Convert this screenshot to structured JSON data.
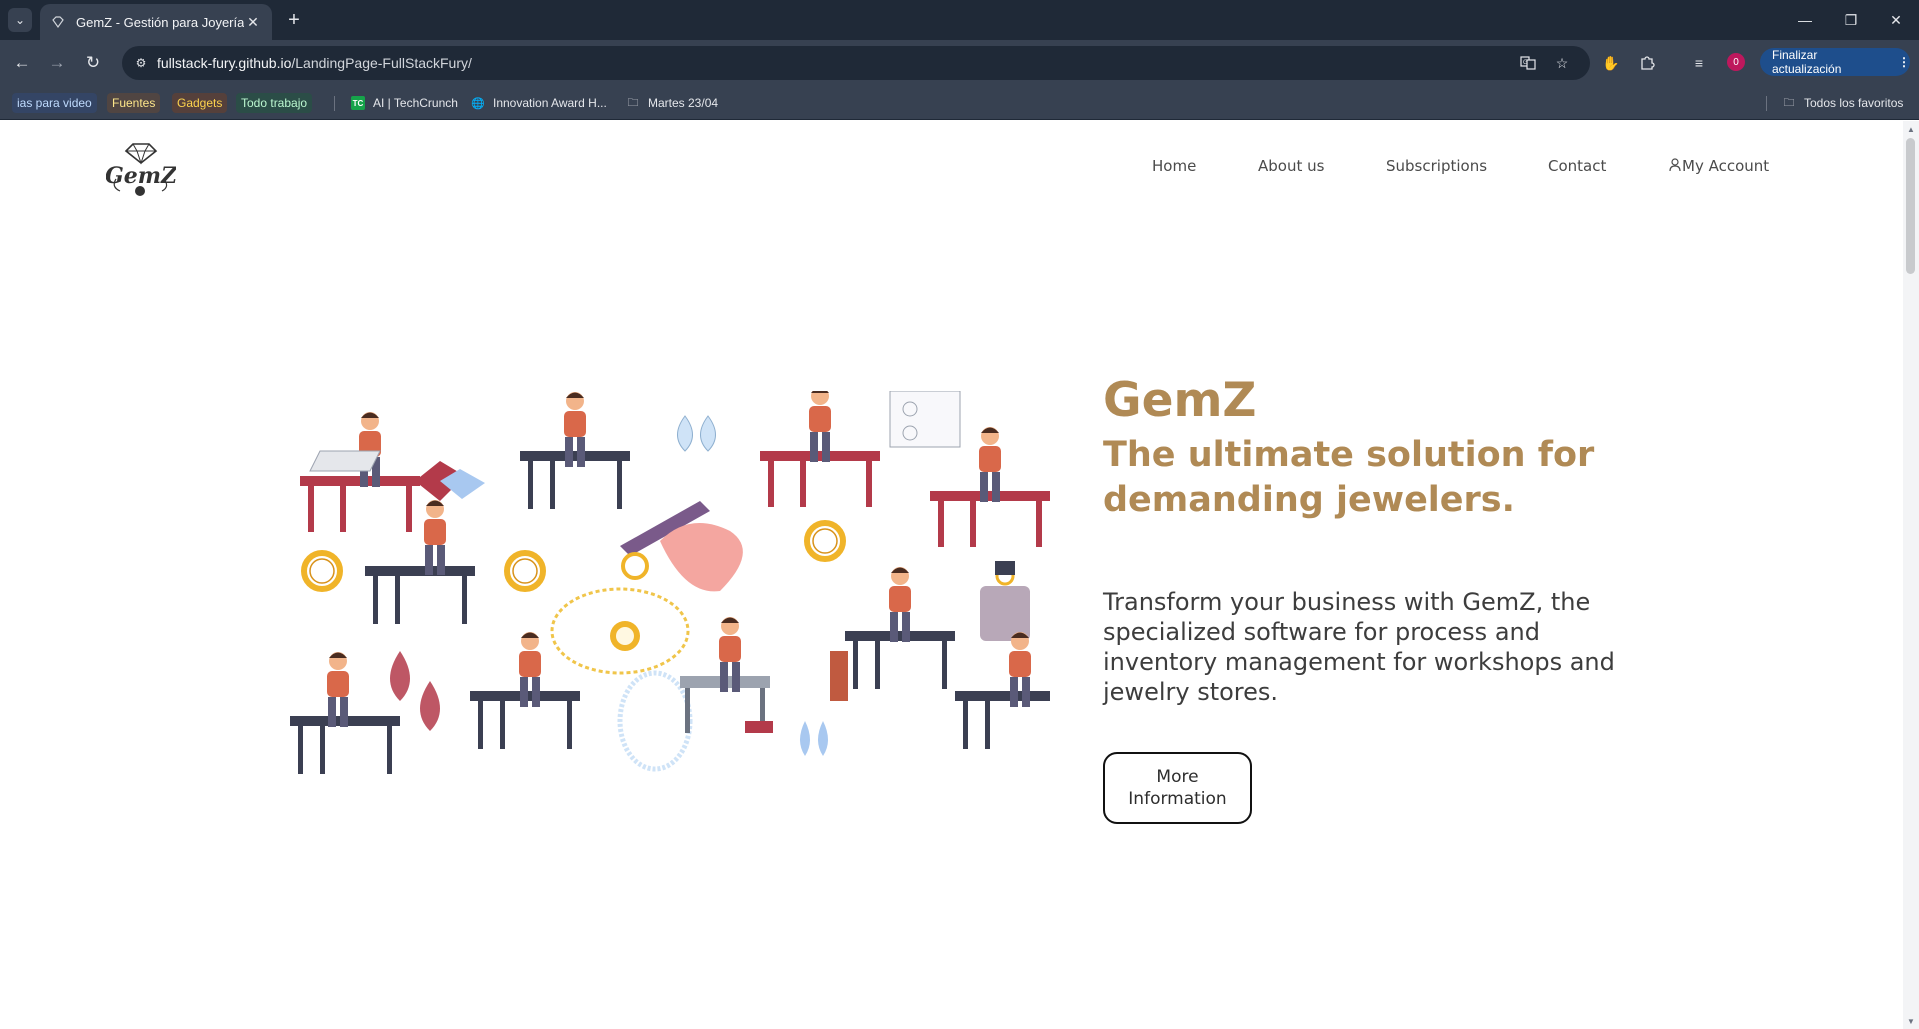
{
  "browser": {
    "tab": {
      "title": "GemZ - Gestión para Joyerías"
    },
    "url": {
      "host": "fullstack-fury.github.io",
      "path": "/LandingPage-FullStackFury/"
    },
    "profile_badge": "0",
    "update_button": "Finalizar actualización",
    "bookmarks": [
      {
        "label": "ias para video",
        "color": "#2563eb"
      },
      {
        "label": "Fuentes",
        "color": "#b45309"
      },
      {
        "label": "Gadgets",
        "color": "#92400e"
      },
      {
        "label": "Todo trabajo",
        "color": "#166534"
      },
      {
        "label": "AI | TechCrunch"
      },
      {
        "label": "Innovation Award H..."
      },
      {
        "label": "Martes 23/04"
      }
    ],
    "all_bookmarks": "Todos los favoritos"
  },
  "site": {
    "logo_text": "GemZ",
    "nav": {
      "home": "Home",
      "about": "About us",
      "subscriptions": "Subscriptions",
      "contact": "Contact",
      "account": "My Account"
    },
    "hero": {
      "brand": "GemZ",
      "title": "The ultimate solution for demanding jewelers.",
      "description": "Transform your business with GemZ, the specialized software for process and inventory management for workshops and jewelry stores.",
      "button": "More Information"
    },
    "colors": {
      "accent": "#b08a55",
      "text": "#3d3d3d"
    }
  }
}
